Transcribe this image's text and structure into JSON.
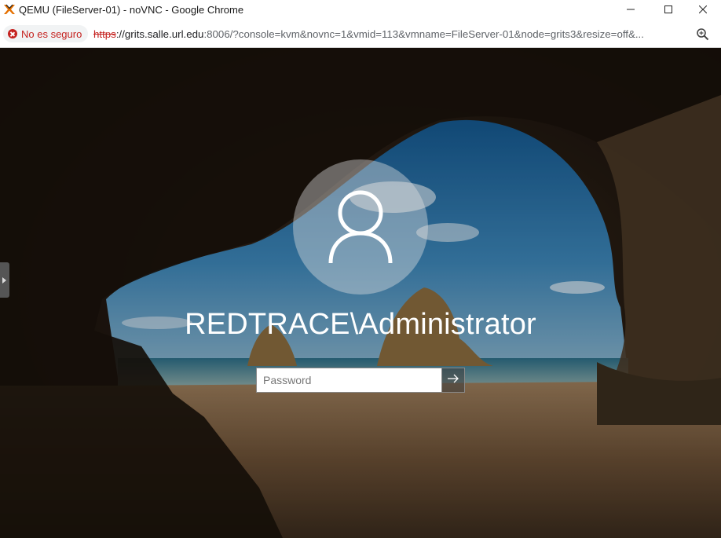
{
  "window": {
    "title": "QEMU (FileServer-01) - noVNC - Google Chrome"
  },
  "address_bar": {
    "security_label": "No es seguro",
    "url_scheme": "https",
    "url_host": "://grits.salle.url.edu",
    "url_rest": ":8006/?console=kvm&novnc=1&vmid=113&vmname=FileServer-01&node=grits3&resize=off&..."
  },
  "login": {
    "username": "REDTRACE\\Administrator",
    "password_placeholder": "Password",
    "password_value": ""
  },
  "icons": {
    "app": "proxmox-icon",
    "minimize": "minimize-icon",
    "maximize": "maximize-icon",
    "close": "close-icon",
    "zoom": "zoom-icon",
    "avatar": "user-icon",
    "submit": "arrow-right-icon"
  },
  "colors": {
    "insecure": "#c5221f",
    "text_white": "#ffffff"
  }
}
